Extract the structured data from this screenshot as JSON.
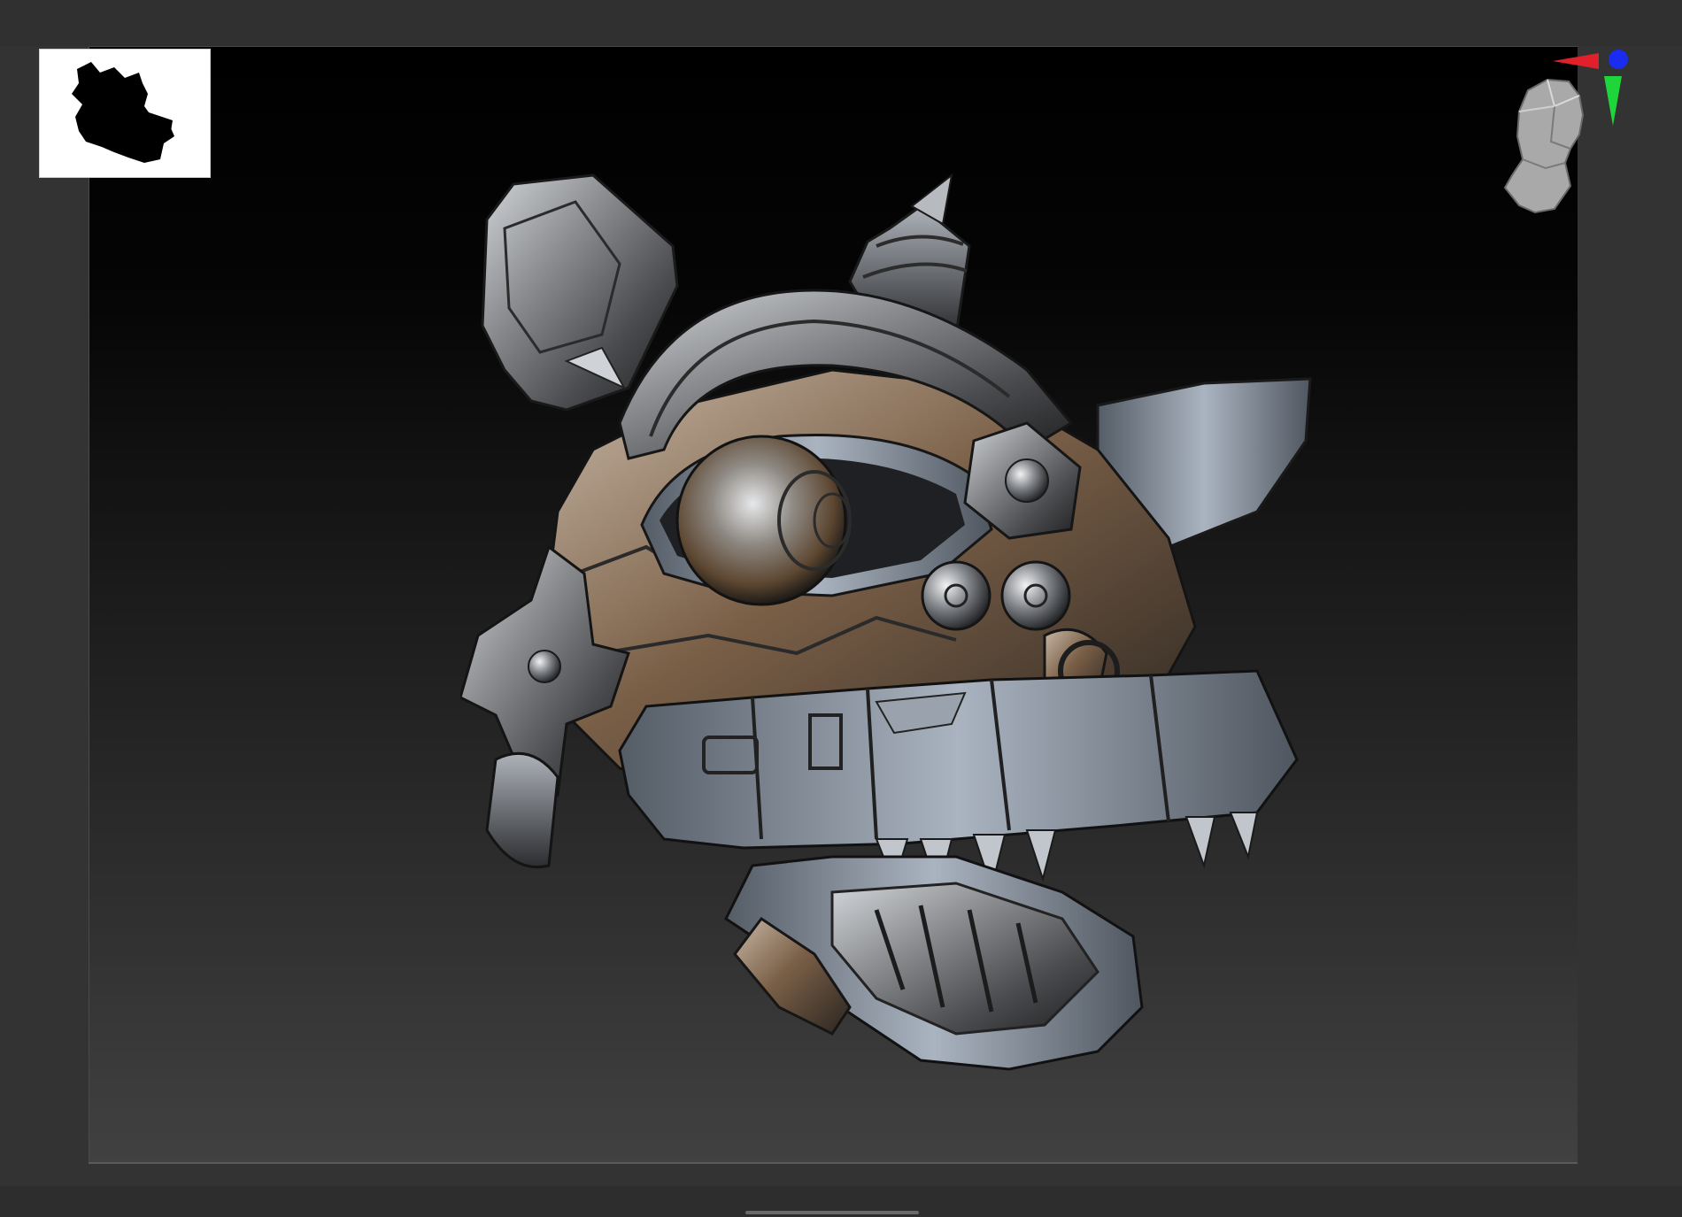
{
  "window": {
    "title": ""
  },
  "viewport": {
    "background_top": "#000000",
    "background_bottom": "#414141",
    "model_material": "metallic-grey-matcap",
    "model_subject": "mechanical-dragon-head-sculpt"
  },
  "colors": {
    "axis_x": "#e0202a",
    "axis_y": "#1fd63a",
    "axis_z": "#1a2cf0",
    "metal_light": "#c9cdd2",
    "metal_mid": "#7d7f82",
    "metal_dark": "#2a2a2c",
    "metal_warm": "#8a6a4c"
  },
  "icons": {
    "silhouette": "silhouette-preview-icon",
    "navigator_head": "head-navigator-icon",
    "axis_gizmo": "axis-gizmo-icon"
  }
}
